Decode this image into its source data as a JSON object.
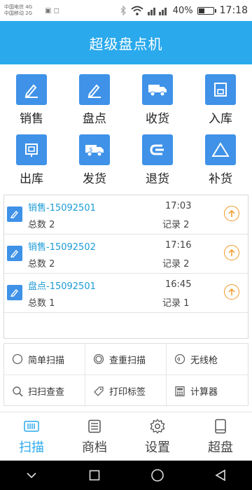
{
  "status_bar": {
    "carrier_1": "中国电信 4G",
    "carrier_2": "中国移动 2G",
    "battery_percent": "40%",
    "battery_level": 0.4,
    "clock": "17:18"
  },
  "header": {
    "title": "超级盘点机"
  },
  "functions": [
    {
      "label": "销售",
      "icon": "pencil-icon"
    },
    {
      "label": "盘点",
      "icon": "pencil-icon"
    },
    {
      "label": "收货",
      "icon": "truck-icon"
    },
    {
      "label": "入库",
      "icon": "box-in-icon"
    },
    {
      "label": "出库",
      "icon": "box-out-icon"
    },
    {
      "label": "发货",
      "icon": "truck-icon"
    },
    {
      "label": "退货",
      "icon": "return-icon"
    },
    {
      "label": "补货",
      "icon": "triangle-icon"
    }
  ],
  "records": [
    {
      "title": "销售-15092501",
      "total": "总数 2",
      "time": "17:03",
      "count": "记录 2"
    },
    {
      "title": "销售-15092502",
      "total": "总数 2",
      "time": "17:16",
      "count": "记录 2"
    },
    {
      "title": "盘点-15092501",
      "total": "总数 1",
      "time": "16:45",
      "count": "记录 1"
    }
  ],
  "tools": [
    {
      "label": "简单扫描",
      "icon": "circle-icon"
    },
    {
      "label": "查重扫描",
      "icon": "target-icon"
    },
    {
      "label": "无线枪",
      "icon": "wireless-icon"
    },
    {
      "label": "扫扫查查",
      "icon": "search-icon"
    },
    {
      "label": "打印标签",
      "icon": "tag-icon"
    },
    {
      "label": "计算器",
      "icon": "calculator-icon"
    }
  ],
  "tabs": [
    {
      "label": "扫描",
      "icon": "barcode-icon",
      "active": true
    },
    {
      "label": "商档",
      "icon": "document-icon"
    },
    {
      "label": "设置",
      "icon": "gear-icon"
    },
    {
      "label": "超盘",
      "icon": "tablet-icon"
    }
  ],
  "colors": {
    "accent": "#2aa9ec",
    "icon_blue": "#3f92e8",
    "upload_orange": "#f09a28"
  }
}
